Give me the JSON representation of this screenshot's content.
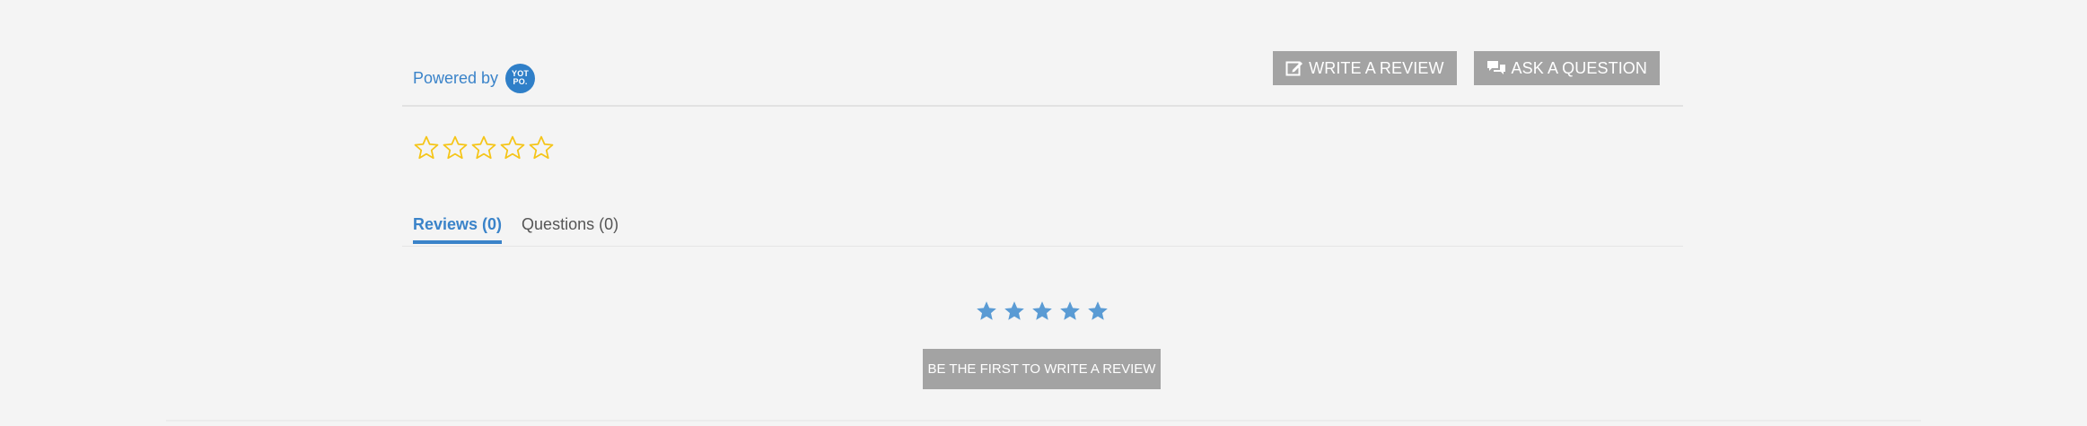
{
  "header": {
    "powered_by": "Powered by",
    "logo_line1": "YOT",
    "logo_line2": "PO."
  },
  "actions": {
    "write_review_label": "WRITE A REVIEW",
    "ask_question_label": "ASK A QUESTION"
  },
  "summary": {
    "rating": 0,
    "max_stars": 5,
    "star_color": "#f5c518"
  },
  "tabs": [
    {
      "label": "Reviews (0)",
      "active": true
    },
    {
      "label": "Questions (0)",
      "active": false
    }
  ],
  "empty_state": {
    "star_color": "#5a9bd4",
    "button_label": "BE THE FIRST TO WRITE A REVIEW"
  },
  "colors": {
    "accent": "#3a83c9",
    "button_bg": "#a3a3a3",
    "background": "#f4f4f4"
  }
}
